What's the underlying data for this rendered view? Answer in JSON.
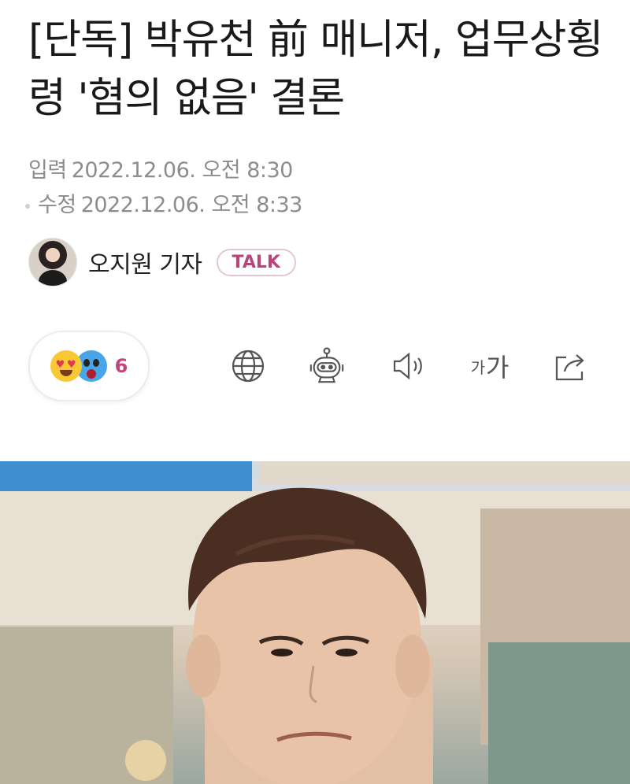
{
  "article": {
    "headline": "[단독] 박유천 前 매니저, 업무상횡령 '혐의 없음' 결론",
    "published_label": "입력",
    "published_time": "2022.12.06. 오전 8:30",
    "modified_label": "수정",
    "modified_time": "2022.12.06. 오전 8:33"
  },
  "author": {
    "name": "오지원 기자",
    "talk_label": "TALK"
  },
  "reactions": {
    "icons": [
      "heart-eyes-emoji",
      "shocked-emoji"
    ],
    "count": "6"
  },
  "toolbar": {
    "icons": [
      "globe-icon",
      "robot-icon",
      "speaker-icon",
      "font-size-icon",
      "share-icon"
    ],
    "font_small": "가",
    "font_large": "가"
  },
  "photo": {
    "subject": "man-portrait"
  },
  "colors": {
    "accent": "#c4447a",
    "meta_text": "#8c8c8c",
    "headline_text": "#1a1a1a",
    "icon": "#555555"
  }
}
